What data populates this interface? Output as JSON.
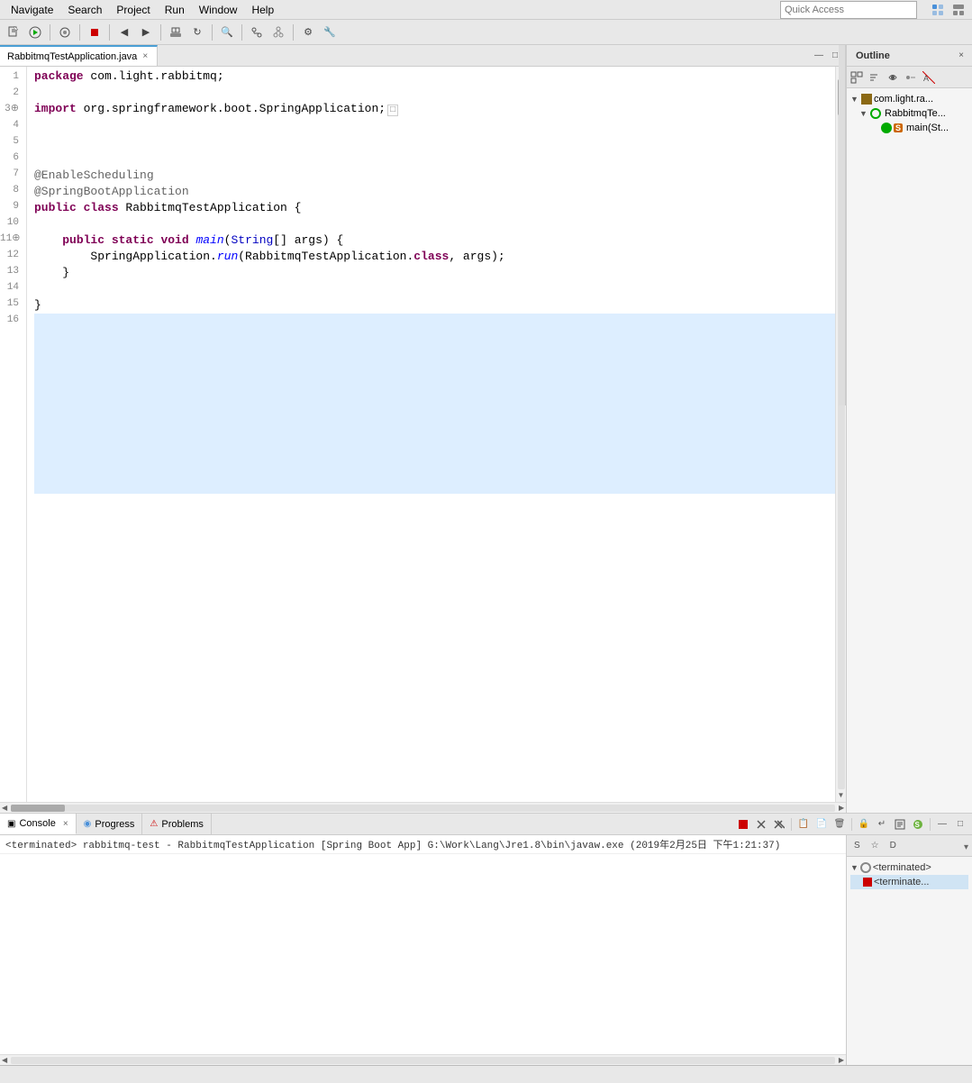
{
  "menu": {
    "items": [
      "Navigate",
      "Search",
      "Project",
      "Run",
      "Window",
      "Help"
    ]
  },
  "toolbar": {
    "quick_access_placeholder": "Quick Access"
  },
  "editor": {
    "tab": {
      "label": "RabbitmqTestApplication.java",
      "close": "×"
    },
    "lines": [
      {
        "num": "1",
        "content": "package com.light.rabbitmq;",
        "tokens": [
          {
            "text": "package ",
            "class": "kw"
          },
          {
            "text": "com.light.rabbitmq;",
            "class": "normal"
          }
        ]
      },
      {
        "num": "2",
        "content": "",
        "tokens": []
      },
      {
        "num": "3",
        "content": "import org.springframework.boot.SpringApplication;",
        "tokens": [
          {
            "text": "import ",
            "class": "kw"
          },
          {
            "text": "org.springframework.boot.SpringApplication;",
            "class": "normal"
          }
        ],
        "has_fold": true
      },
      {
        "num": "4",
        "content": "",
        "tokens": []
      },
      {
        "num": "5",
        "content": "",
        "tokens": []
      },
      {
        "num": "6",
        "content": "",
        "tokens": []
      },
      {
        "num": "7",
        "content": "@EnableScheduling",
        "tokens": [
          {
            "text": "@EnableScheduling",
            "class": "ann"
          }
        ]
      },
      {
        "num": "8",
        "content": "@SpringBootApplication",
        "tokens": [
          {
            "text": "@SpringBootApplication",
            "class": "ann"
          }
        ]
      },
      {
        "num": "9",
        "content": "public class RabbitmqTestApplication {",
        "tokens": [
          {
            "text": "public ",
            "class": "kw"
          },
          {
            "text": "class ",
            "class": "kw"
          },
          {
            "text": "RabbitmqTestApplication ",
            "class": "normal"
          },
          {
            "text": "{",
            "class": "normal"
          }
        ]
      },
      {
        "num": "10",
        "content": "",
        "tokens": []
      },
      {
        "num": "11",
        "content": "    public static void main(String[] args) {",
        "tokens": [
          {
            "text": "    ",
            "class": "normal"
          },
          {
            "text": "public ",
            "class": "kw"
          },
          {
            "text": "static ",
            "class": "kw"
          },
          {
            "text": "void ",
            "class": "kw"
          },
          {
            "text": "main",
            "class": "method"
          },
          {
            "text": "(",
            "class": "normal"
          },
          {
            "text": "String",
            "class": "type"
          },
          {
            "text": "[] args) {",
            "class": "normal"
          }
        ],
        "has_dot": true
      },
      {
        "num": "12",
        "content": "        SpringApplication.run(RabbitmqTestApplication.class, args);",
        "tokens": [
          {
            "text": "        SpringApplication.",
            "class": "normal"
          },
          {
            "text": "run",
            "class": "method"
          },
          {
            "text": "(RabbitmqTestApplication.",
            "class": "normal"
          },
          {
            "text": "class",
            "class": "kw"
          },
          {
            "text": ", args);",
            "class": "normal"
          }
        ]
      },
      {
        "num": "13",
        "content": "    }",
        "tokens": [
          {
            "text": "    }",
            "class": "normal"
          }
        ]
      },
      {
        "num": "14",
        "content": "",
        "tokens": []
      },
      {
        "num": "15",
        "content": "}",
        "tokens": [
          {
            "text": "}",
            "class": "normal"
          }
        ]
      },
      {
        "num": "16",
        "content": "",
        "tokens": [],
        "highlighted": true
      }
    ]
  },
  "outline": {
    "title": "Outline",
    "close": "×",
    "items": [
      {
        "label": "com.light.ra...",
        "type": "package",
        "indent": 0,
        "expanded": true
      },
      {
        "label": "RabbitmqTe...",
        "type": "class",
        "indent": 1,
        "expanded": true
      },
      {
        "label": "main(St...",
        "type": "method",
        "indent": 2
      }
    ]
  },
  "bottom": {
    "tabs": [
      {
        "label": "Console",
        "active": true,
        "icon": "console"
      },
      {
        "label": "Progress",
        "active": false,
        "icon": "progress"
      },
      {
        "label": "Problems",
        "active": false,
        "icon": "problems"
      }
    ],
    "console_status": "<terminated> rabbitmq-test - RabbitmqTestApplication [Spring Boot App] G:\\Work\\Lang\\Jre1.8\\bin\\javaw.exe (2019年2月25日 下午1:21:37)",
    "right_panel": {
      "tabs": [
        "S",
        "☆",
        "D"
      ],
      "terminated_label": "<terminated>",
      "terminated_sub": "<terminate..."
    }
  },
  "status_bar": {
    "text": ""
  }
}
